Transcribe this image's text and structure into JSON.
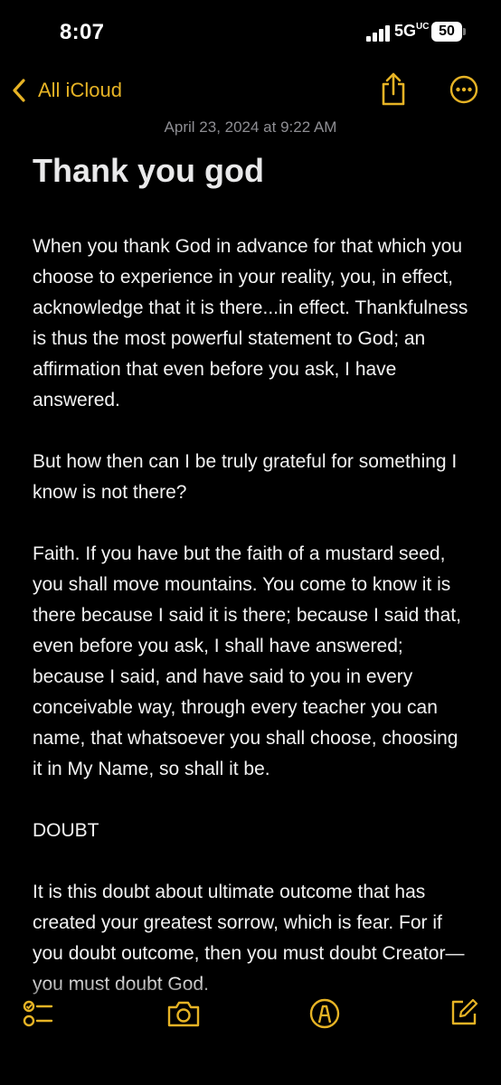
{
  "status_bar": {
    "time": "8:07",
    "network": "5G",
    "network_suffix": "UC",
    "battery": "50"
  },
  "nav": {
    "back_label": "All iCloud"
  },
  "note": {
    "date": "April 23, 2024 at 9:22 AM",
    "title": "Thank you god",
    "paragraphs": [
      "When you thank God in advance for that which you choose to experience in your reality, you, in effect, acknowledge that it is there...in effect. Thankfulness is thus the most powerful statement to God; an affirmation that even before you ask, I have answered.",
      "But how then can I be truly grateful for something I know is not there?",
      "Faith. If you have but the faith of a mustard seed, you shall move mountains. You come to know it is there because I said it is there; because I said that, even before you ask, I shall have answered; because I said, and have said to you in every conceivable way, through every teacher you can name, that whatsoever you shall choose, choosing it in My Name, so shall it be.",
      "DOUBT",
      "It is this doubt about ultimate outcome that has created your greatest sorrow, which is fear. For if you doubt outcome, then you must doubt Creator—you must doubt God."
    ]
  },
  "toolbar": [
    "checklist-icon",
    "camera-icon",
    "markup-icon",
    "compose-icon"
  ],
  "colors": {
    "accent": "#e6b325",
    "background": "#000000",
    "secondary_text": "#8e8e93"
  }
}
